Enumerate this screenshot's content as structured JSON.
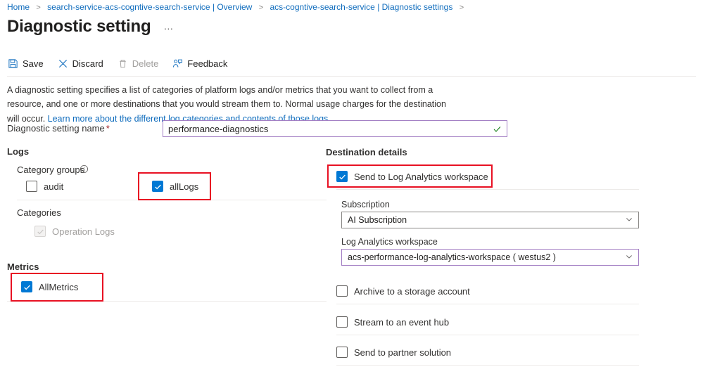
{
  "breadcrumb": {
    "items": [
      {
        "label": "Home"
      },
      {
        "label": "search-service-acs-cogntive-search-service | Overview"
      },
      {
        "label": "acs-cogntive-search-service | Diagnostic settings"
      }
    ],
    "separator": ">"
  },
  "header": {
    "title": "Diagnostic setting",
    "more_label": "…"
  },
  "toolbar": {
    "save_label": "Save",
    "discard_label": "Discard",
    "delete_label": "Delete",
    "feedback_label": "Feedback"
  },
  "description": {
    "text": "A diagnostic setting specifies a list of categories of platform logs and/or metrics that you want to collect from a resource, and one or more destinations that you would stream them to. Normal usage charges for the destination will occur. ",
    "link_text": "Learn more about the different log categories and contents of those logs"
  },
  "name_field": {
    "label": "Diagnostic setting name",
    "required_mark": "*",
    "value": "performance-diagnostics",
    "placeholder": "Diagnostic setting name",
    "valid_icon": "checkmark-icon"
  },
  "logs": {
    "heading": "Logs",
    "category_groups_label": "Category groups",
    "info_icon": "info-icon",
    "categories_label": "Categories",
    "category_groups": [
      {
        "label": "audit",
        "checked": false,
        "disabled": false
      },
      {
        "label": "allLogs",
        "checked": true,
        "disabled": false
      }
    ],
    "categories": [
      {
        "label": "Operation Logs",
        "checked": true,
        "disabled": true
      }
    ]
  },
  "metrics": {
    "heading": "Metrics",
    "items": [
      {
        "label": "AllMetrics",
        "checked": true,
        "disabled": false
      }
    ]
  },
  "destination": {
    "heading": "Destination details",
    "send_log_analytics": {
      "label": "Send to Log Analytics workspace",
      "checked": true
    },
    "subscription": {
      "label": "Subscription",
      "value": "AI Subscription",
      "chevron": "chevron-down-icon"
    },
    "workspace": {
      "label": "Log Analytics workspace",
      "value": "acs-performance-log-analytics-workspace ( westus2 )",
      "chevron": "chevron-down-icon"
    },
    "options": [
      {
        "label": "Archive to a storage account",
        "checked": false
      },
      {
        "label": "Stream to an event hub",
        "checked": false
      },
      {
        "label": "Send to partner solution",
        "checked": false
      }
    ]
  },
  "colors": {
    "accent_blue": "#0078d4",
    "link_blue": "#0f6cbd",
    "annotation_red": "#e81123",
    "input_border_violet": "#a37fc4",
    "valid_green": "#107c10",
    "required_red": "#a4262c"
  }
}
